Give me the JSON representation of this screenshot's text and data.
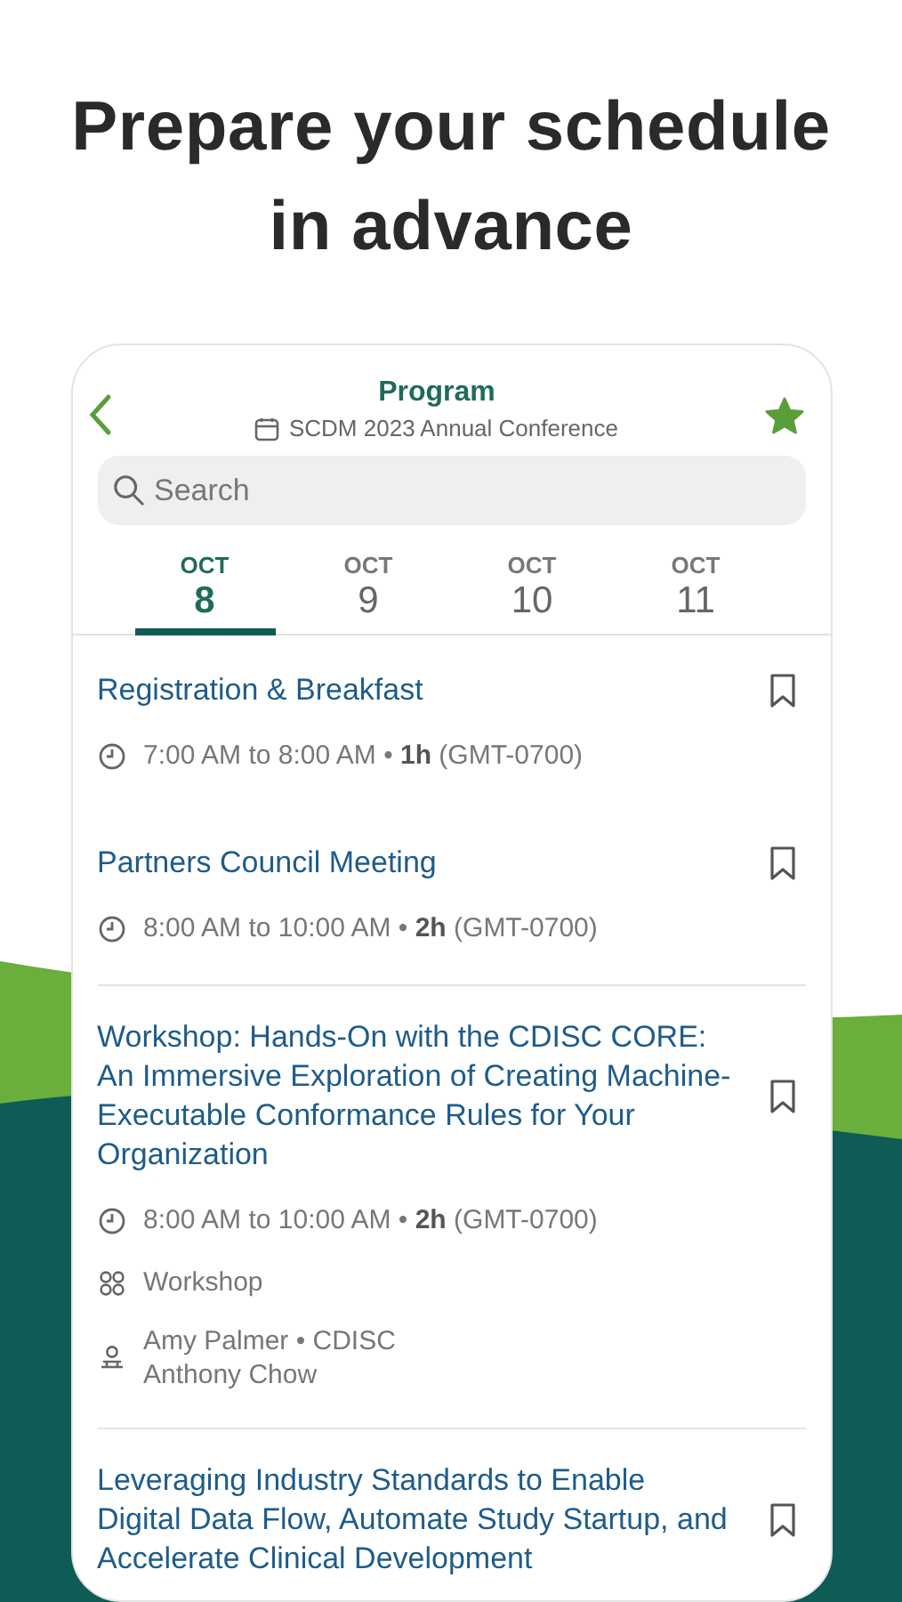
{
  "headline": "Prepare your schedule in advance",
  "header": {
    "title": "Program",
    "subtitle": "SCDM 2023 Annual Conference",
    "favorite": true
  },
  "search": {
    "placeholder": "Search"
  },
  "dates": [
    {
      "month": "OCT",
      "day": "8",
      "selected": true
    },
    {
      "month": "OCT",
      "day": "9",
      "selected": false
    },
    {
      "month": "OCT",
      "day": "10",
      "selected": false
    },
    {
      "month": "OCT",
      "day": "11",
      "selected": false
    }
  ],
  "sessions": [
    {
      "title": "Registration & Breakfast",
      "time": "7:00 AM to 8:00 AM • **1h** (GMT-0700)",
      "bookmarked": false,
      "divider": false
    },
    {
      "title": "Partners Council Meeting",
      "time": "8:00 AM to 10:00 AM • **2h** (GMT-0700)",
      "bookmarked": false,
      "divider": true
    },
    {
      "title": "Workshop: Hands-On with the CDISC CORE: An Immersive Exploration of Creating Machine-Executable Conformance Rules for Your Organization",
      "time": "8:00 AM to 10:00 AM • **2h** (GMT-0700)",
      "type": "Workshop",
      "speakers": [
        "Amy Palmer • CDISC",
        "Anthony Chow"
      ],
      "bookmarked": false,
      "divider": true
    },
    {
      "title": "Leveraging Industry Standards to Enable Digital Data Flow, Automate Study Startup, and Accelerate Clinical Development",
      "bookmarked": false,
      "divider": false
    }
  ]
}
